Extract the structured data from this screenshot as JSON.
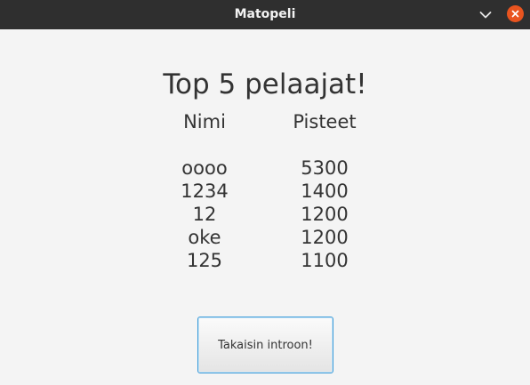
{
  "window": {
    "title": "Matopeli",
    "minimize_icon": "chevron-down-icon",
    "close_icon": "close-icon",
    "close_color": "#e9541f"
  },
  "main": {
    "heading": "Top 5 pelaajat!",
    "names_header": "Nimi",
    "scores_header": "Pisteet",
    "rows": [
      {
        "name": "oooo",
        "score": "5300"
      },
      {
        "name": "1234",
        "score": "1400"
      },
      {
        "name": "12",
        "score": "1200"
      },
      {
        "name": "oke",
        "score": "1200"
      },
      {
        "name": "125",
        "score": "1100"
      }
    ],
    "back_button_label": "Takaisin introon!"
  }
}
